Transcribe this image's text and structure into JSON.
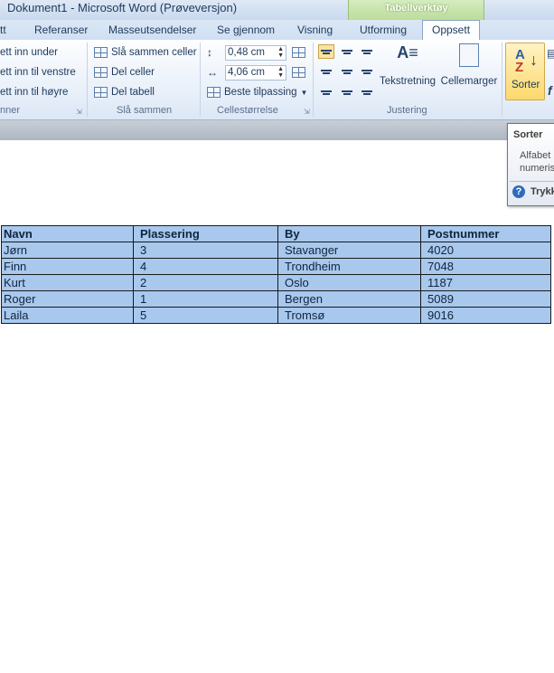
{
  "window": {
    "title": "Dokument1  -  Microsoft Word (Prøveversjon)"
  },
  "context_group": {
    "label": "Tabellverktøy",
    "color": "#bcdc9c"
  },
  "tabs": [
    {
      "label": "tt"
    },
    {
      "label": "Referanser"
    },
    {
      "label": "Masseutsendelser"
    },
    {
      "label": "Se gjennom"
    },
    {
      "label": "Visning"
    },
    {
      "label": "Utforming"
    },
    {
      "label": "Oppsett"
    }
  ],
  "ribbon": {
    "rows_cols": {
      "items": [
        "ett inn under",
        "ett inn til venstre",
        "ett inn til høyre"
      ],
      "group_label": "nner"
    },
    "merge": {
      "items": [
        "Slå sammen celler",
        "Del celler",
        "Del tabell"
      ],
      "group_label": "Slå sammen"
    },
    "cellsize": {
      "height_value": "0,48 cm",
      "width_value": "4,06 cm",
      "autofit_label": "Beste tilpassing",
      "group_label": "Cellestørrelse"
    },
    "alignment": {
      "text_direction_label": "Tekstretning",
      "cell_margins_label": "Cellemarger",
      "group_label": "Justering"
    },
    "sort": {
      "label": "Sorter",
      "glyph_a": "A",
      "glyph_z": "Z"
    }
  },
  "tooltip": {
    "title": "Sorter",
    "body_line1": "Alfabet",
    "body_line2": "numeris",
    "help_text": "Trykk"
  },
  "table": {
    "headers": [
      "Navn",
      "Plassering",
      "By",
      "Postnummer"
    ],
    "rows": [
      [
        "Jørn",
        "3",
        "Stavanger",
        "4020"
      ],
      [
        "Finn",
        "4",
        "Trondheim",
        "7048"
      ],
      [
        "Kurt",
        "2",
        "Oslo",
        "1187"
      ],
      [
        "Roger",
        "1",
        "Bergen",
        "5089"
      ],
      [
        "Laila",
        "5",
        "Tromsø",
        "9016"
      ]
    ],
    "fill_color": "#a8c8ed"
  }
}
